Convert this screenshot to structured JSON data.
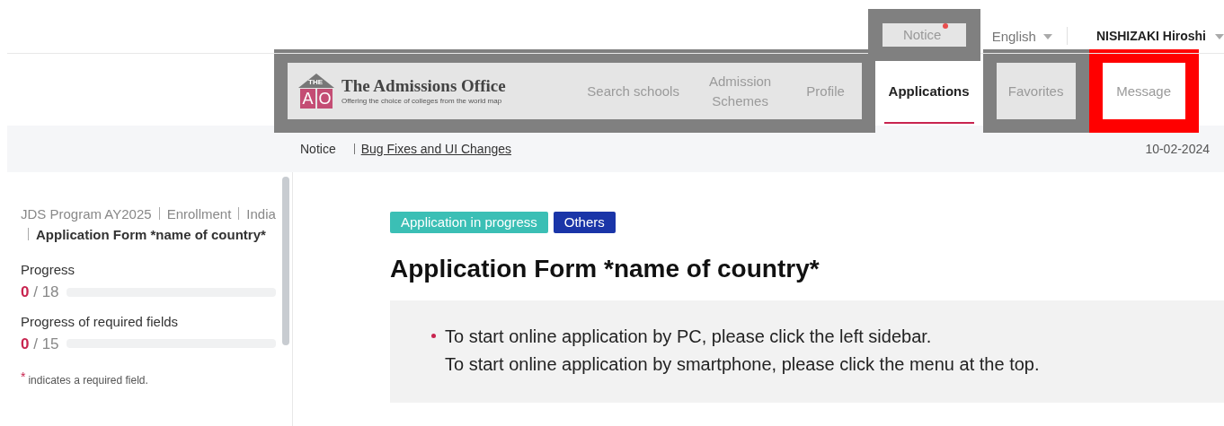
{
  "top_bar": {
    "notice": {
      "label": "Notice",
      "unread": true,
      "highlight": {
        "color": "#808080",
        "shaded": true
      }
    },
    "language": {
      "label": "English"
    },
    "user": {
      "label": "NISHIZAKI Hiroshi"
    }
  },
  "logo": {
    "roof_text": "THE",
    "letters": [
      "A",
      "O"
    ],
    "title": "The Admissions Office",
    "tagline": "Offering the choice of colleges from the world map",
    "highlight": {
      "color": "#808080",
      "shaded": true
    }
  },
  "nav": [
    {
      "label": "Search schools",
      "selected": false,
      "highlight": {
        "color": "#808080",
        "shaded": true
      }
    },
    {
      "label": "Admission Schemes",
      "selected": false,
      "highlight": {
        "color": "#808080",
        "shaded": true
      }
    },
    {
      "label": "Profile",
      "selected": false,
      "highlight": {
        "color": "#808080",
        "shaded": true
      }
    },
    {
      "label": "Applications",
      "selected": true
    },
    {
      "label": "Favorites",
      "selected": false,
      "highlight": {
        "color": "#808080",
        "shaded": true
      }
    },
    {
      "label": "Message",
      "selected": false,
      "highlight": {
        "color": "#ff0000",
        "shaded": false
      }
    }
  ],
  "notice_bar": {
    "label": "Notice",
    "link": "Bug Fixes and UI Changes",
    "date": "10-02-2024"
  },
  "sidebar": {
    "breadcrumb": [
      {
        "label": "JDS Program AY2025",
        "current": false
      },
      {
        "label": "Enrollment",
        "current": false
      },
      {
        "label": "India",
        "current": false
      },
      {
        "label": "Application Form *name of country*",
        "current": true
      }
    ],
    "progress": [
      {
        "label": "Progress",
        "count": "0",
        "total": "/ 18",
        "level": 0
      },
      {
        "label": "Progress of required fields",
        "count": "0",
        "total": "/ 15",
        "level": 0
      }
    ],
    "footnote": {
      "mark": "*",
      "text": "indicates a required field."
    }
  },
  "main": {
    "badges": [
      {
        "label": "Application in progress",
        "color": "#3bbfb5"
      },
      {
        "label": "Others",
        "color": "#1a35a8"
      }
    ],
    "title": "Application Form *name of country*",
    "instructions": [
      {
        "lines": [
          "To start online application by PC, please click the left sidebar.",
          "To start online application by smartphone, please click the menu at the top."
        ]
      }
    ]
  }
}
